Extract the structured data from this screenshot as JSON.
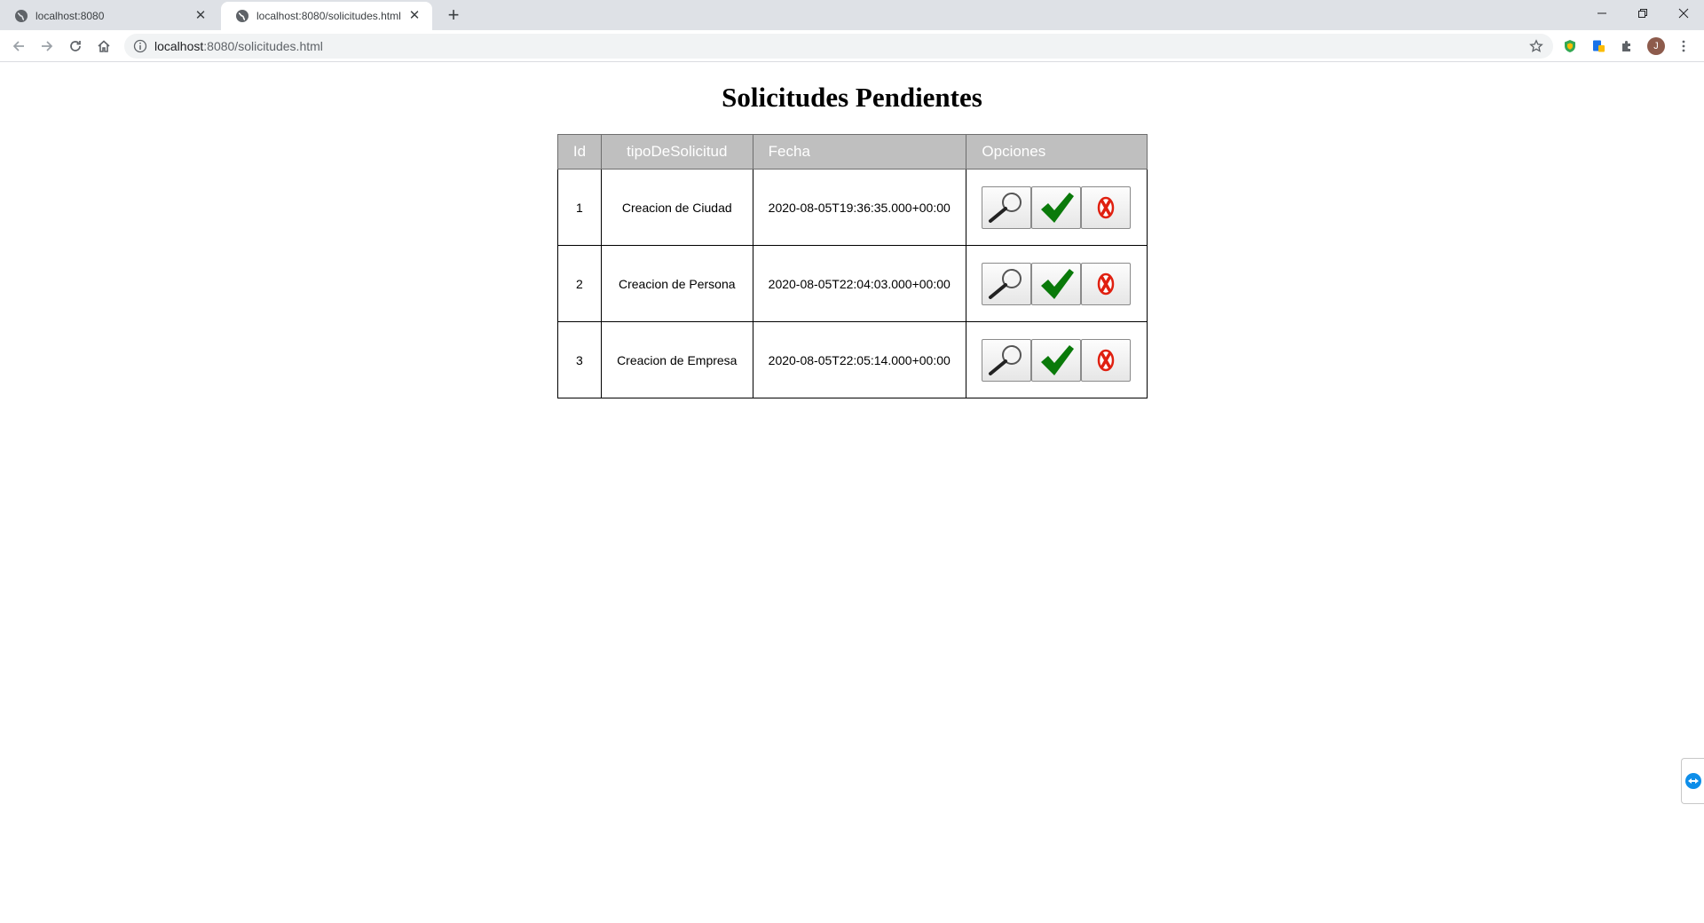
{
  "browser": {
    "tabs": [
      {
        "title": "localhost:8080",
        "active": false
      },
      {
        "title": "localhost:8080/solicitudes.html",
        "active": true
      }
    ],
    "url_host": "localhost",
    "url_path": ":8080/solicitudes.html",
    "avatar_initial": "J"
  },
  "page": {
    "title": "Solicitudes Pendientes"
  },
  "table": {
    "headers": [
      "Id",
      "tipoDeSolicitud",
      "Fecha",
      "Opciones"
    ],
    "rows": [
      {
        "id": "1",
        "tipo": "Creacion de Ciudad",
        "fecha": "2020-08-05T19:36:35.000+00:00"
      },
      {
        "id": "2",
        "tipo": "Creacion de Persona",
        "fecha": "2020-08-05T22:04:03.000+00:00"
      },
      {
        "id": "3",
        "tipo": "Creacion de Empresa",
        "fecha": "2020-08-05T22:05:14.000+00:00"
      }
    ],
    "option_icons": [
      "magnifier-icon",
      "checkmark-icon",
      "reject-x-icon"
    ]
  },
  "colors": {
    "header_bg": "#bfbfbf",
    "check_green": "#0a7a0a",
    "reject_red": "#e02010"
  }
}
